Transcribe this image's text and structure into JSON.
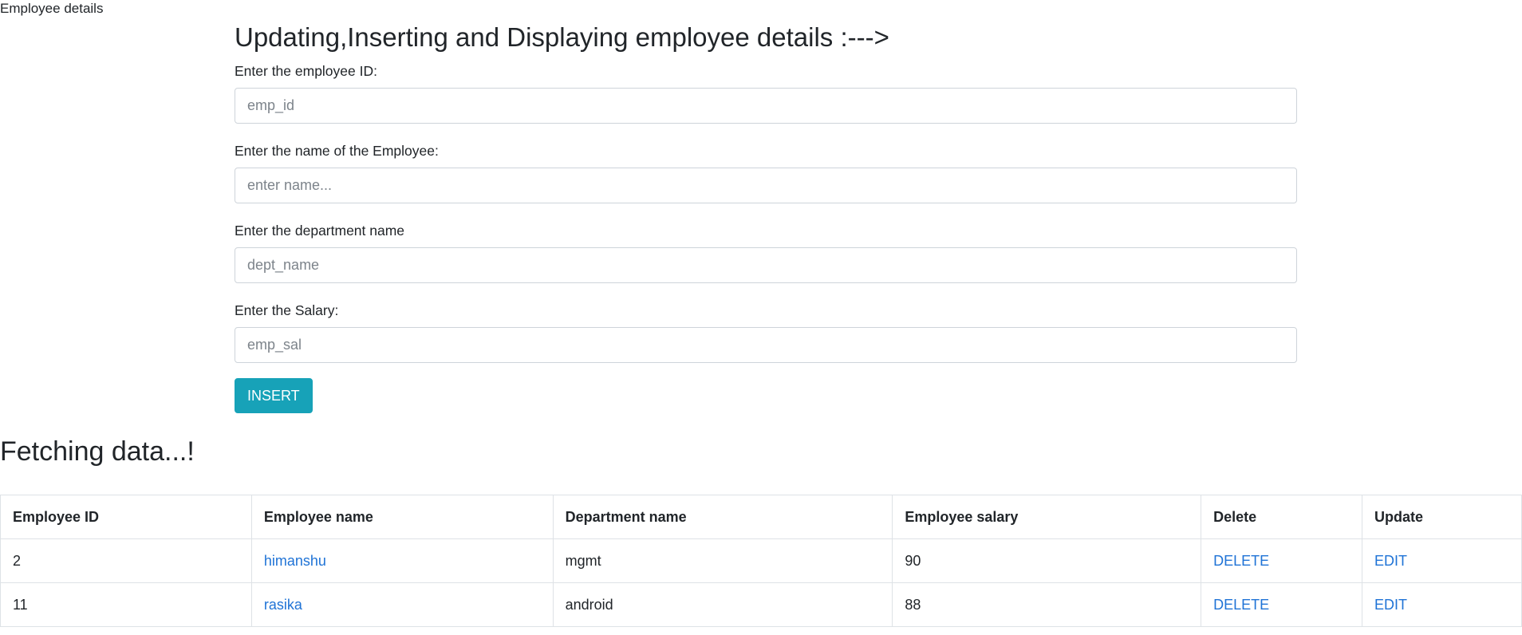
{
  "page": {
    "label": "Employee details"
  },
  "form": {
    "title": "Updating,Inserting and Displaying employee details :--->",
    "fields": [
      {
        "label": "Enter the employee ID:",
        "placeholder": "emp_id",
        "value": ""
      },
      {
        "label": "Enter the name of the Employee:",
        "placeholder": "enter name...",
        "value": ""
      },
      {
        "label": "Enter the department name",
        "placeholder": "dept_name",
        "value": ""
      },
      {
        "label": "Enter the Salary:",
        "placeholder": "emp_sal",
        "value": ""
      }
    ],
    "submit_label": "INSERT"
  },
  "table": {
    "title": "Fetching data...!",
    "headers": [
      "Employee ID",
      "Employee name",
      "Department name",
      "Employee salary",
      "Delete",
      "Update"
    ],
    "rows": [
      {
        "id": "2",
        "name": "himanshu",
        "department": "mgmt",
        "salary": "90",
        "delete_label": "DELETE",
        "edit_label": "EDIT"
      },
      {
        "id": "11",
        "name": "rasika",
        "department": "android",
        "salary": "88",
        "delete_label": "DELETE",
        "edit_label": "EDIT"
      }
    ]
  },
  "colors": {
    "button_bg": "#17a2b8",
    "link": "#1f73d6",
    "text": "#212529",
    "border": "#dee2e6"
  }
}
